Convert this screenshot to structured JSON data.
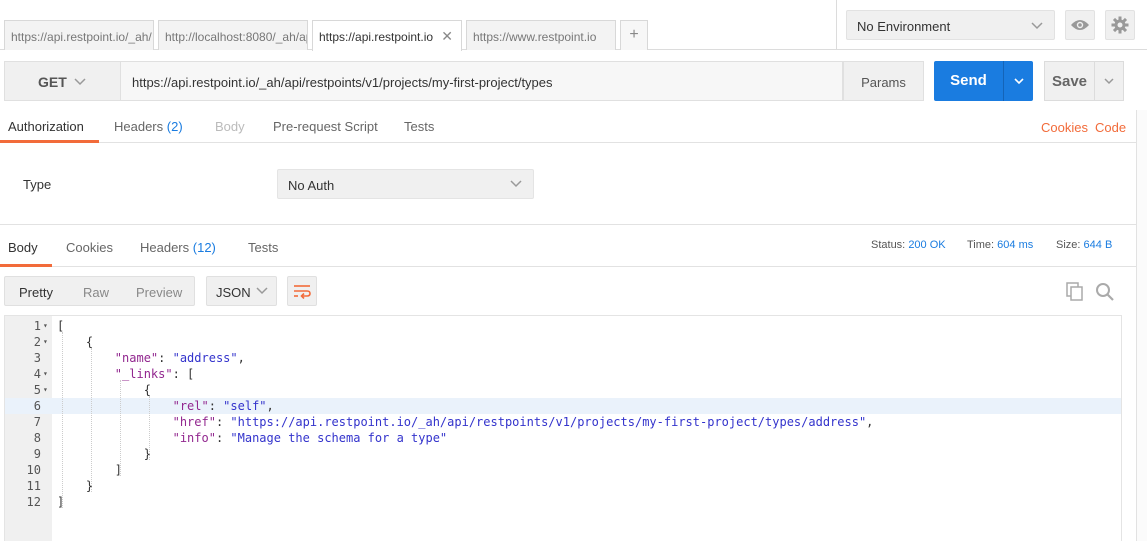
{
  "tabs": [
    {
      "label": "https://api.restpoint.io/_ah/"
    },
    {
      "label": "http://localhost:8080/_ah/ap"
    },
    {
      "label": "https://api.restpoint.io",
      "active": true
    },
    {
      "label": "https://www.restpoint.io"
    }
  ],
  "tab_add": "+",
  "environment": {
    "selected": "No Environment"
  },
  "request": {
    "method": "GET",
    "url": "https://api.restpoint.io/_ah/api/restpoints/v1/projects/my-first-project/types",
    "params_label": "Params",
    "send_label": "Send",
    "save_label": "Save"
  },
  "request_tabs": {
    "authorization": "Authorization",
    "headers": "Headers",
    "headers_count": "(2)",
    "body": "Body",
    "prerequest": "Pre-request Script",
    "tests": "Tests",
    "cookies_link": "Cookies",
    "code_link": "Code"
  },
  "auth": {
    "type_label": "Type",
    "type_value": "No Auth"
  },
  "response_tabs": {
    "body": "Body",
    "cookies": "Cookies",
    "headers": "Headers",
    "headers_count": "(12)",
    "tests": "Tests"
  },
  "response_meta": {
    "status_label": "Status:",
    "status_value": "200 OK",
    "time_label": "Time:",
    "time_value": "604 ms",
    "size_label": "Size:",
    "size_value": "644 B"
  },
  "viewer": {
    "modes": [
      "Pretty",
      "Raw",
      "Preview"
    ],
    "active_mode": "Pretty",
    "format": "JSON"
  },
  "code_lines": [
    {
      "n": "1",
      "fold": true,
      "text": "["
    },
    {
      "n": "2",
      "fold": true,
      "text": "    {"
    },
    {
      "n": "3",
      "fold": false,
      "key": "\"name\"",
      "value": "\"address\"",
      "indent": "        ",
      "suffix": ","
    },
    {
      "n": "4",
      "fold": true,
      "key": "\"_links\"",
      "indent": "        ",
      "rest": ": ["
    },
    {
      "n": "5",
      "fold": true,
      "text": "            {"
    },
    {
      "n": "6",
      "fold": false,
      "key": "\"rel\"",
      "value": "\"self\"",
      "indent": "                ",
      "suffix": ","
    },
    {
      "n": "7",
      "fold": false,
      "key": "\"href\"",
      "value": "\"https://api.restpoint.io/_ah/api/restpoints/v1/projects/my-first-project/types/address\"",
      "indent": "                ",
      "suffix": ","
    },
    {
      "n": "8",
      "fold": false,
      "key": "\"info\"",
      "value": "\"Manage the schema for a type\"",
      "indent": "                ",
      "suffix": ""
    },
    {
      "n": "9",
      "fold": false,
      "text": "            }"
    },
    {
      "n": "10",
      "fold": false,
      "text": "        ]"
    },
    {
      "n": "11",
      "fold": false,
      "text": "    }"
    },
    {
      "n": "12",
      "fold": false,
      "text": "]"
    }
  ],
  "highlighted_line": "6",
  "icons": {
    "eye": "eye-icon",
    "settings": "gear-icon",
    "copy": "copy-icon",
    "search": "search-icon",
    "wrap": "wrap-lines-icon",
    "close": "close-icon",
    "chevron": "chevron-down-icon"
  },
  "colors": {
    "accent_blue": "#1a7ce0",
    "accent_orange": "#f26b3a",
    "json_key": "#92278f",
    "json_string": "#3333cc"
  }
}
